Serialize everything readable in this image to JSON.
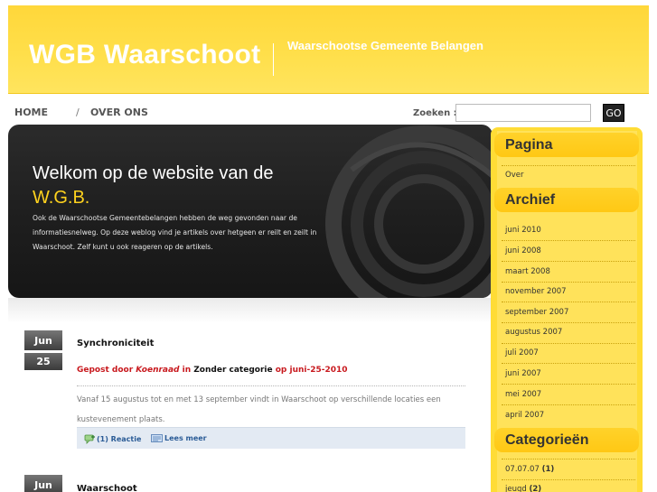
{
  "header": {
    "site_title": "WGB Waarschoot",
    "tagline": "Waarschootse Gemeente Belangen"
  },
  "nav": {
    "home": "HOME",
    "separator": "/",
    "over_ons": "OVER ONS",
    "search_label": "Zoeken :",
    "search_value": "",
    "go_button": "GO"
  },
  "banner": {
    "heading": "Welkom op de website van de",
    "heading_accent": "W.G.B.",
    "text": "Ook de Waarschootse Gemeentebelangen hebben de weg gevonden naar de informatiesnelweg. Op deze weblog vind je artikels over hetgeen er reilt en zeilt in Waarschoot. Zelf kunt u ook reageren op de artikels."
  },
  "posts": [
    {
      "month": "Jun",
      "day": "25",
      "title": "Synchroniciteit",
      "meta_prefix": "Gepost door ",
      "author": "Koenraad",
      "meta_in": " in ",
      "category": "Zonder categorie",
      "meta_on": " op ",
      "date": "juni-25-2010",
      "body": "Vanaf 15 augustus tot en met 13 september vindt in Waarschoot op verschillende locaties een kustevenement plaats.",
      "comments": "(1) Reactie",
      "read_more": "Lees meer"
    },
    {
      "month": "Jun",
      "title": "Waarschoot"
    }
  ],
  "sidebar": {
    "pagina_heading": "Pagina",
    "pagina_items": [
      "Over"
    ],
    "archief_heading": "Archief",
    "archief_items": [
      "juni 2010",
      "juni 2008",
      "maart 2008",
      "november 2007",
      "september 2007",
      "augustus 2007",
      "juli 2007",
      "juni 2007",
      "mei 2007",
      "april 2007"
    ],
    "categorieen_heading": "Categorieën",
    "categorieen_items": [
      {
        "name": "07.07.07",
        "count": "(1)"
      },
      {
        "name": "jeugd",
        "count": "(2)"
      }
    ]
  },
  "colors": {
    "header_yellow": "#ffdf4a",
    "sidebar_yellow": "#ffdc36",
    "banner_dark": "#1e1e1e",
    "accent_red": "#c8191e",
    "link_blue": "#2a5b96"
  }
}
